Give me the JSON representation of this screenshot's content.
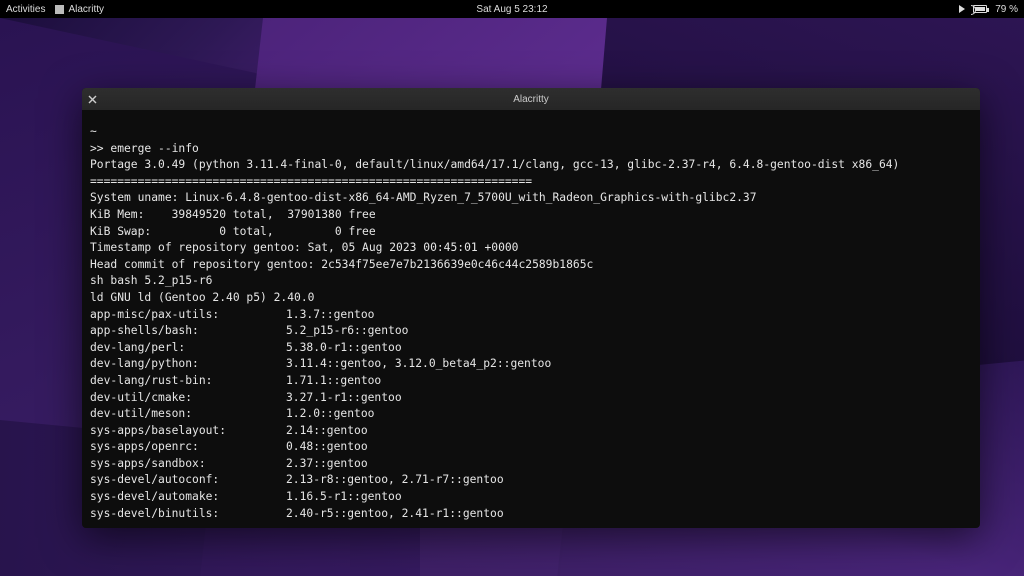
{
  "topbar": {
    "activities": "Activities",
    "app_name": "Alacritty",
    "clock": "Sat Aug 5  23:12",
    "battery": "79 %"
  },
  "window": {
    "title": "Alacritty"
  },
  "terminal": {
    "cwd_line": "~",
    "prompt": ">> ",
    "command": "emerge --info",
    "portage_line": "Portage 3.0.49 (python 3.11.4-final-0, default/linux/amd64/17.1/clang, gcc-13, glibc-2.37-r4, 6.4.8-gentoo-dist x86_64)",
    "divider": "=================================================================",
    "uname": "System uname: Linux-6.4.8-gentoo-dist-x86_64-AMD_Ryzen_7_5700U_with_Radeon_Graphics-with-glibc2.37",
    "mem": "KiB Mem:    39849520 total,  37901380 free",
    "swap": "KiB Swap:          0 total,         0 free",
    "repo_ts": "Timestamp of repository gentoo: Sat, 05 Aug 2023 00:45:01 +0000",
    "repo_head": "Head commit of repository gentoo: 2c534f75ee7e7b2136639e0c46c44c2589b1865c",
    "sh": "sh bash 5.2_p15-r6",
    "ld": "ld GNU ld (Gentoo 2.40 p5) 2.40.0",
    "packages": [
      {
        "name": "app-misc/pax-utils:",
        "ver": "1.3.7::gentoo"
      },
      {
        "name": "app-shells/bash:",
        "ver": "5.2_p15-r6::gentoo"
      },
      {
        "name": "dev-lang/perl:",
        "ver": "5.38.0-r1::gentoo"
      },
      {
        "name": "dev-lang/python:",
        "ver": "3.11.4::gentoo, 3.12.0_beta4_p2::gentoo"
      },
      {
        "name": "dev-lang/rust-bin:",
        "ver": "1.71.1::gentoo"
      },
      {
        "name": "dev-util/cmake:",
        "ver": "3.27.1-r1::gentoo"
      },
      {
        "name": "dev-util/meson:",
        "ver": "1.2.0::gentoo"
      },
      {
        "name": "sys-apps/baselayout:",
        "ver": "2.14::gentoo"
      },
      {
        "name": "sys-apps/openrc:",
        "ver": "0.48::gentoo"
      },
      {
        "name": "sys-apps/sandbox:",
        "ver": "2.37::gentoo"
      },
      {
        "name": "sys-devel/autoconf:",
        "ver": "2.13-r8::gentoo, 2.71-r7::gentoo"
      },
      {
        "name": "sys-devel/automake:",
        "ver": "1.16.5-r1::gentoo"
      },
      {
        "name": "sys-devel/binutils:",
        "ver": "2.40-r5::gentoo, 2.41-r1::gentoo"
      }
    ]
  }
}
